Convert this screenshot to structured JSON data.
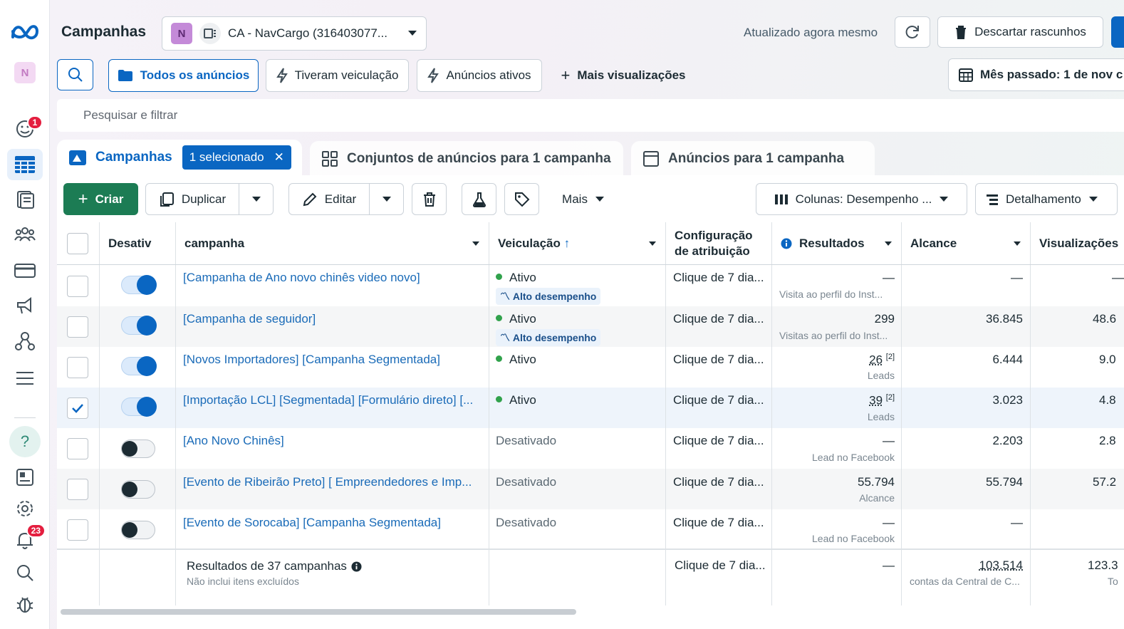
{
  "header": {
    "title": "Campanhas",
    "account_initial": "N",
    "account_name": "CA - NavCargo (316403077...",
    "updated_text": "Atualizado agora mesmo",
    "discard_label": "Descartar rascunhos"
  },
  "nav": {
    "profile_initial": "N",
    "badge_notifications": "1",
    "badge_alerts": "23",
    "help": "?"
  },
  "views": {
    "all_ads": "Todos os anúncios",
    "had_delivery": "Tiveram veiculação",
    "active_ads": "Anúncios ativos",
    "more_views": "Mais visualizações",
    "date_range": "Mês passado: 1 de nov c"
  },
  "search": {
    "placeholder": "Pesquisar e filtrar"
  },
  "tabs": {
    "campaigns": "Campanhas",
    "selected_chip": "1 selecionado",
    "ad_sets": "Conjuntos de anúncios para 1 campanha",
    "ads": "Anúncios para 1 campanha"
  },
  "toolbar": {
    "create": "Criar",
    "duplicate": "Duplicar",
    "edit": "Editar",
    "more": "Mais",
    "columns": "Colunas: Desempenho ...",
    "breakdown": "Detalhamento"
  },
  "table": {
    "headers": {
      "off": "Desativ",
      "campaign": "campanha",
      "delivery": "Veiculação",
      "attribution_1": "Configuração",
      "attribution_2": "de atribuição",
      "results": "Resultados",
      "reach": "Alcance",
      "views": "Visualizações"
    },
    "rows": [
      {
        "checked": false,
        "on": true,
        "name": "[Campanha de Ano novo chinês video novo]",
        "delivery": "Ativo",
        "active": true,
        "badge": "Alto desempenho",
        "attr": "Clique de 7 dia...",
        "result": "—",
        "result_sub": "Visita ao perfil do Inst...",
        "reach": "—",
        "views": "—"
      },
      {
        "checked": false,
        "on": true,
        "name": "[Campanha de seguidor]",
        "delivery": "Ativo",
        "active": true,
        "badge": "Alto desempenho",
        "attr": "Clique de 7 dia...",
        "result": "299",
        "result_sub": "Visitas ao perfil do Inst...",
        "reach": "36.845",
        "views": "48.6"
      },
      {
        "checked": false,
        "on": true,
        "name": "[Novos Importadores] [Campanha Segmentada]",
        "delivery": "Ativo",
        "active": true,
        "badge": "",
        "attr": "Clique de 7 dia...",
        "result": "26",
        "result_note": "[2]",
        "result_sub": "Leads",
        "reach": "6.444",
        "views": "9.0"
      },
      {
        "checked": true,
        "on": true,
        "name": "[Importação LCL] [Segmentada] [Formulário direto] [...",
        "delivery": "Ativo",
        "active": true,
        "badge": "",
        "attr": "Clique de 7 dia...",
        "result": "39",
        "result_note": "[2]",
        "result_sub": "Leads",
        "reach": "3.023",
        "views": "4.8"
      },
      {
        "checked": false,
        "on": false,
        "name": "[Ano Novo Chinês]",
        "delivery": "Desativado",
        "active": false,
        "badge": "",
        "attr": "Clique de 7 dia...",
        "result": "—",
        "result_sub": "Lead no Facebook",
        "reach": "2.203",
        "views": "2.8"
      },
      {
        "checked": false,
        "on": false,
        "name": "[Evento de Ribeirão Preto] [ Empreendedores e Imp...",
        "delivery": "Desativado",
        "active": false,
        "badge": "",
        "attr": "Clique de 7 dia...",
        "result": "55.794",
        "result_sub": "Alcance",
        "reach": "55.794",
        "views": "57.2"
      },
      {
        "checked": false,
        "on": false,
        "name": "[Evento de Sorocaba] [Campanha Segmentada]",
        "delivery": "Desativado",
        "active": false,
        "badge": "",
        "attr": "Clique de 7 dia...",
        "result": "—",
        "result_sub": "Lead no Facebook",
        "reach": "—",
        "views": ""
      }
    ],
    "footer": {
      "label": "Resultados de 37 campanhas",
      "sub": "Não inclui itens excluídos",
      "attr": "Clique de 7 dia...",
      "result": "—",
      "reach": "103.514",
      "reach_sub": "contas da Central de C...",
      "views": "123.3",
      "views_sub": "To"
    }
  },
  "colors": {
    "accent": "#0a66c2",
    "create_green": "#1c7c54",
    "active_dot": "#31a24c",
    "badge_red": "#e41e3f"
  }
}
